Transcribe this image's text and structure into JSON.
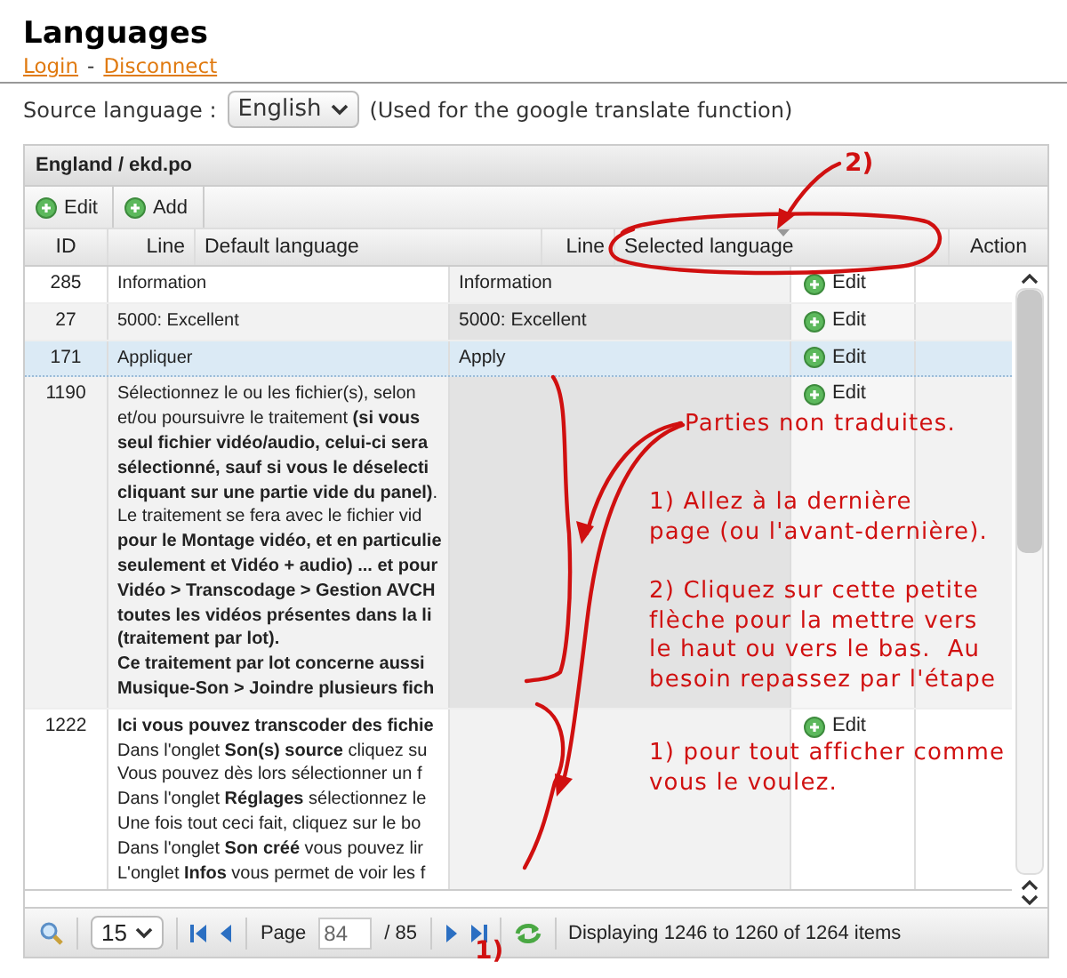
{
  "page": {
    "title": "Languages",
    "links": [
      "Login",
      "Disconnect"
    ],
    "separator": "-"
  },
  "source_language": {
    "label": "Source language :",
    "value": "English",
    "note": "(Used for the google translate function)"
  },
  "grid": {
    "title": "England / ekd.po",
    "toolbar": [
      "Edit",
      "Add"
    ],
    "columns": [
      {
        "label": "ID",
        "sorted": false
      },
      {
        "label": "Line",
        "sorted": false
      },
      {
        "label": "Default language",
        "sorted": false
      },
      {
        "label": "Line",
        "sorted": false
      },
      {
        "label": "Selected language",
        "sorted": true
      },
      {
        "label": "Action",
        "sorted": false
      }
    ],
    "rows": [
      {
        "id": "285",
        "default": [
          "Information"
        ],
        "translation": "Information",
        "action": "Edit",
        "selected": false
      },
      {
        "id": "27",
        "default": [
          "5000: Excellent"
        ],
        "translation": "5000: Excellent",
        "action": "Edit",
        "selected": false
      },
      {
        "id": "171",
        "default": [
          "Appliquer"
        ],
        "translation": "Apply",
        "action": "Edit",
        "selected": true
      },
      {
        "id": "1190",
        "default": [
          "Sélectionnez le ou les fichier(s), selon",
          "et/ou poursuivre le traitement **(si vous**",
          "**seul fichier vidéo/audio, celui-ci sera**",
          "**sélectionné, sauf si vous le déselecti**",
          "**cliquant sur une partie vide du panel)**.",
          "Le traitement se fera avec le fichier vid",
          "**pour le Montage vidéo, et en particulie**",
          "**seulement et Vidéo + audio) ... et pour**",
          "**Vidéo > Transcodage > Gestion AVCH**",
          "**toutes les vidéos présentes dans la li**",
          "**(traitement par lot).**",
          "**Ce traitement par lot concerne aussi**",
          "**Musique-Son > Joindre plusieurs fich**"
        ],
        "translation": "",
        "action": "Edit",
        "selected": false
      },
      {
        "id": "1222",
        "default": [
          "**Ici vous pouvez transcoder des fichie**",
          "Dans l'onglet **Son(s) source** cliquez su",
          "Vous pouvez dès lors sélectionner un f",
          "Dans l'onglet **Réglages** sélectionnez le",
          "Une fois tout ceci fait, cliquez sur le bo",
          "Dans l'onglet **Son créé** vous pouvez lir",
          "L'onglet **Infos** vous permet de voir les f"
        ],
        "translation": "",
        "action": "Edit",
        "selected": false
      }
    ],
    "pager": {
      "page_size": "15",
      "page_label": "Page",
      "page": "84",
      "total": "/ 85",
      "status": "Displaying 1246 to 1260 of 1264 items"
    }
  },
  "annotations": {
    "notes": [
      "Parties non traduites.",
      "1) Allez à la dernière\npage (ou l'avant-dernière).",
      "2) Cliquez sur cette petite\nflèche pour la mettre vers\nle haut ou vers le bas.  Au\nbesoin repassez par l'étape",
      "1) pour tout afficher comme\nvous le voulez."
    ],
    "step_marks": [
      "2)",
      "1)"
    ]
  }
}
